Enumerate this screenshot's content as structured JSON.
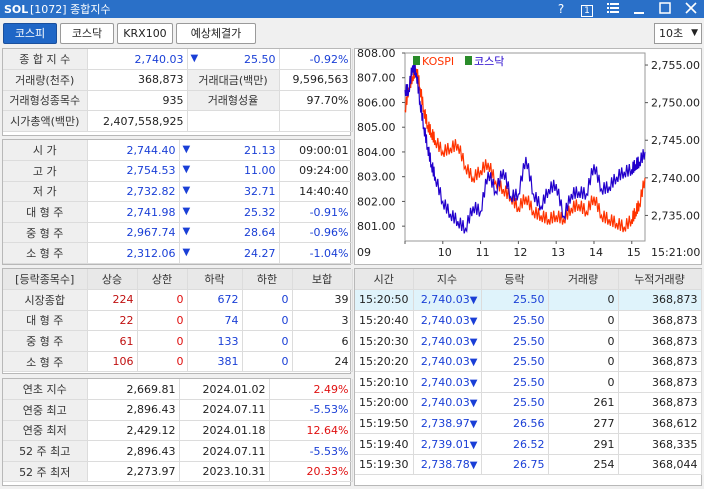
{
  "titlebar": {
    "logo": "SOL",
    "title": "[1072] 종합지수",
    "help": "?",
    "box": "1",
    "menu_icon": "menu-icon",
    "minimize_icon": "minimize-icon",
    "maximize_icon": "maximize-icon",
    "close_icon": "close-icon"
  },
  "tabs": [
    "코스피",
    "코스닥",
    "KRX100",
    "예상체결가"
  ],
  "interval_select": {
    "value": "10초"
  },
  "summary": {
    "composite_label": "종 합 지 수",
    "composite_value": "2,740.03",
    "composite_change": "25.50",
    "composite_rate": "-0.92%",
    "volume_label": "거래량(천주)",
    "volume_value": "368,873",
    "amount_label": "거래대금(백만)",
    "amount_value": "9,596,563",
    "issues_label": "거래형성종목수",
    "issues_value": "935",
    "formation_label": "거래형성율",
    "formation_value": "97.70%",
    "marketcap_label": "시가총액(백만)",
    "marketcap_value": "2,407,558,925"
  },
  "prices": [
    {
      "label": "시      가",
      "value": "2,744.40",
      "change": "21.13",
      "extra": "09:00:01"
    },
    {
      "label": "고      가",
      "value": "2,754.53",
      "change": "11.00",
      "extra": "09:24:00"
    },
    {
      "label": "저      가",
      "value": "2,732.82",
      "change": "32.71",
      "extra": "14:40:40"
    },
    {
      "label": "대 형 주",
      "value": "2,741.98",
      "change": "25.32",
      "extra": "-0.91%"
    },
    {
      "label": "중 형 주",
      "value": "2,967.74",
      "change": "28.64",
      "extra": "-0.96%"
    },
    {
      "label": "소 형 주",
      "value": "2,312.06",
      "change": "24.27",
      "extra": "-1.04%"
    }
  ],
  "breadth": {
    "headers": [
      "[등락종목수]",
      "상승",
      "상한",
      "하락",
      "하한",
      "보합"
    ],
    "rows": [
      {
        "label": "시장종합",
        "up": "224",
        "upper": "0",
        "down": "672",
        "lower": "0",
        "flat": "39"
      },
      {
        "label": "대 형 주",
        "up": "22",
        "upper": "0",
        "down": "74",
        "lower": "0",
        "flat": "3"
      },
      {
        "label": "중 형 주",
        "up": "61",
        "upper": "0",
        "down": "133",
        "lower": "0",
        "flat": "6"
      },
      {
        "label": "소 형 주",
        "up": "106",
        "upper": "0",
        "down": "381",
        "lower": "0",
        "flat": "24"
      }
    ]
  },
  "extremes": [
    {
      "label": "연초  지수",
      "value": "2,669.81",
      "date": "2024.01.02",
      "rate": "2.49%"
    },
    {
      "label": "연중  최고",
      "value": "2,896.43",
      "date": "2024.07.11",
      "rate": "-5.53%"
    },
    {
      "label": "연중  최저",
      "value": "2,429.12",
      "date": "2024.01.18",
      "rate": "12.64%"
    },
    {
      "label": "52 주 최고",
      "value": "2,896.43",
      "date": "2024.07.11",
      "rate": "-5.53%"
    },
    {
      "label": "52 주 최저",
      "value": "2,273.97",
      "date": "2023.10.31",
      "rate": "20.33%"
    }
  ],
  "ticks": {
    "headers": [
      "시간",
      "지수",
      "등락",
      "거래량",
      "누적거래량"
    ],
    "rows": [
      {
        "time": "15:20:50",
        "index": "2,740.03",
        "change": "25.50",
        "vol": "0",
        "cum": "368,873"
      },
      {
        "time": "15:20:40",
        "index": "2,740.03",
        "change": "25.50",
        "vol": "0",
        "cum": "368,873"
      },
      {
        "time": "15:20:30",
        "index": "2,740.03",
        "change": "25.50",
        "vol": "0",
        "cum": "368,873"
      },
      {
        "time": "15:20:20",
        "index": "2,740.03",
        "change": "25.50",
        "vol": "0",
        "cum": "368,873"
      },
      {
        "time": "15:20:10",
        "index": "2,740.03",
        "change": "25.50",
        "vol": "0",
        "cum": "368,873"
      },
      {
        "time": "15:20:00",
        "index": "2,740.03",
        "change": "25.50",
        "vol": "261",
        "cum": "368,873"
      },
      {
        "time": "15:19:50",
        "index": "2,738.97",
        "change": "26.56",
        "vol": "277",
        "cum": "368,612"
      },
      {
        "time": "15:19:40",
        "index": "2,739.01",
        "change": "26.52",
        "vol": "291",
        "cum": "368,335"
      },
      {
        "time": "15:19:30",
        "index": "2,738.78",
        "change": "26.75",
        "vol": "254",
        "cum": "368,044"
      }
    ]
  },
  "chart_data": {
    "type": "line",
    "legend": [
      "KOSPI",
      "코스닥"
    ],
    "x_ticks": [
      "09",
      "10",
      "11",
      "12",
      "13",
      "14",
      "15",
      "15:21:00"
    ],
    "left_axis": {
      "ticks": [
        "808.00",
        "807.00",
        "806.00",
        "805.00",
        "804.00",
        "803.00",
        "802.00",
        "801.00"
      ],
      "ylim": [
        800.4,
        808.0
      ]
    },
    "right_axis": {
      "ticks": [
        "2,755.00",
        "2,750.00",
        "2,745.00",
        "2,740.00",
        "2,735.00"
      ],
      "ylim": [
        2731.6,
        2756.6
      ]
    },
    "series": [
      {
        "name": "KOSPI",
        "axis": "right",
        "color": "#ff3300",
        "x": [
          9.0,
          9.1,
          9.2,
          9.3,
          9.4,
          9.5,
          9.6,
          9.7,
          9.8,
          10.0,
          10.2,
          10.4,
          10.6,
          10.8,
          11.0,
          11.2,
          11.4,
          11.6,
          11.8,
          12.0,
          12.2,
          12.4,
          12.6,
          12.8,
          13.0,
          13.2,
          13.4,
          13.6,
          13.8,
          14.0,
          14.2,
          14.4,
          14.6,
          14.8,
          15.0,
          15.1,
          15.2,
          15.35
        ],
        "y": [
          2749,
          2752,
          2753.5,
          2754.5,
          2752,
          2749,
          2747,
          2746,
          2745,
          2743.5,
          2744,
          2744.5,
          2741.5,
          2740,
          2741,
          2742,
          2739.5,
          2738.5,
          2737.5,
          2736,
          2737.5,
          2735.5,
          2735,
          2734.5,
          2735,
          2734.5,
          2736,
          2736.5,
          2735.5,
          2737.5,
          2735,
          2734.5,
          2734,
          2733.5,
          2734.5,
          2735.5,
          2736.5,
          2740
        ]
      },
      {
        "name": "코스닥",
        "axis": "left",
        "color": "#2200cc",
        "x": [
          9.0,
          9.1,
          9.2,
          9.3,
          9.4,
          9.5,
          9.6,
          9.7,
          9.8,
          10.0,
          10.2,
          10.4,
          10.6,
          10.8,
          11.0,
          11.2,
          11.4,
          11.6,
          11.8,
          12.0,
          12.2,
          12.4,
          12.6,
          12.8,
          13.0,
          13.2,
          13.4,
          13.6,
          13.8,
          14.0,
          14.2,
          14.4,
          14.6,
          14.8,
          15.0,
          15.1,
          15.2,
          15.35
        ],
        "y": [
          806.5,
          806.5,
          807.5,
          807.2,
          806.0,
          805.0,
          804.2,
          803.5,
          803.0,
          802.0,
          801.5,
          801.2,
          800.9,
          801.8,
          801.6,
          803.2,
          802.4,
          803.3,
          802.2,
          802.3,
          803.8,
          802.3,
          801.8,
          802.5,
          802.7,
          801.4,
          802.3,
          802.4,
          802.3,
          803.5,
          802.5,
          802.6,
          803.0,
          803.2,
          803.3,
          803.5,
          803.6,
          804.0
        ]
      }
    ]
  }
}
